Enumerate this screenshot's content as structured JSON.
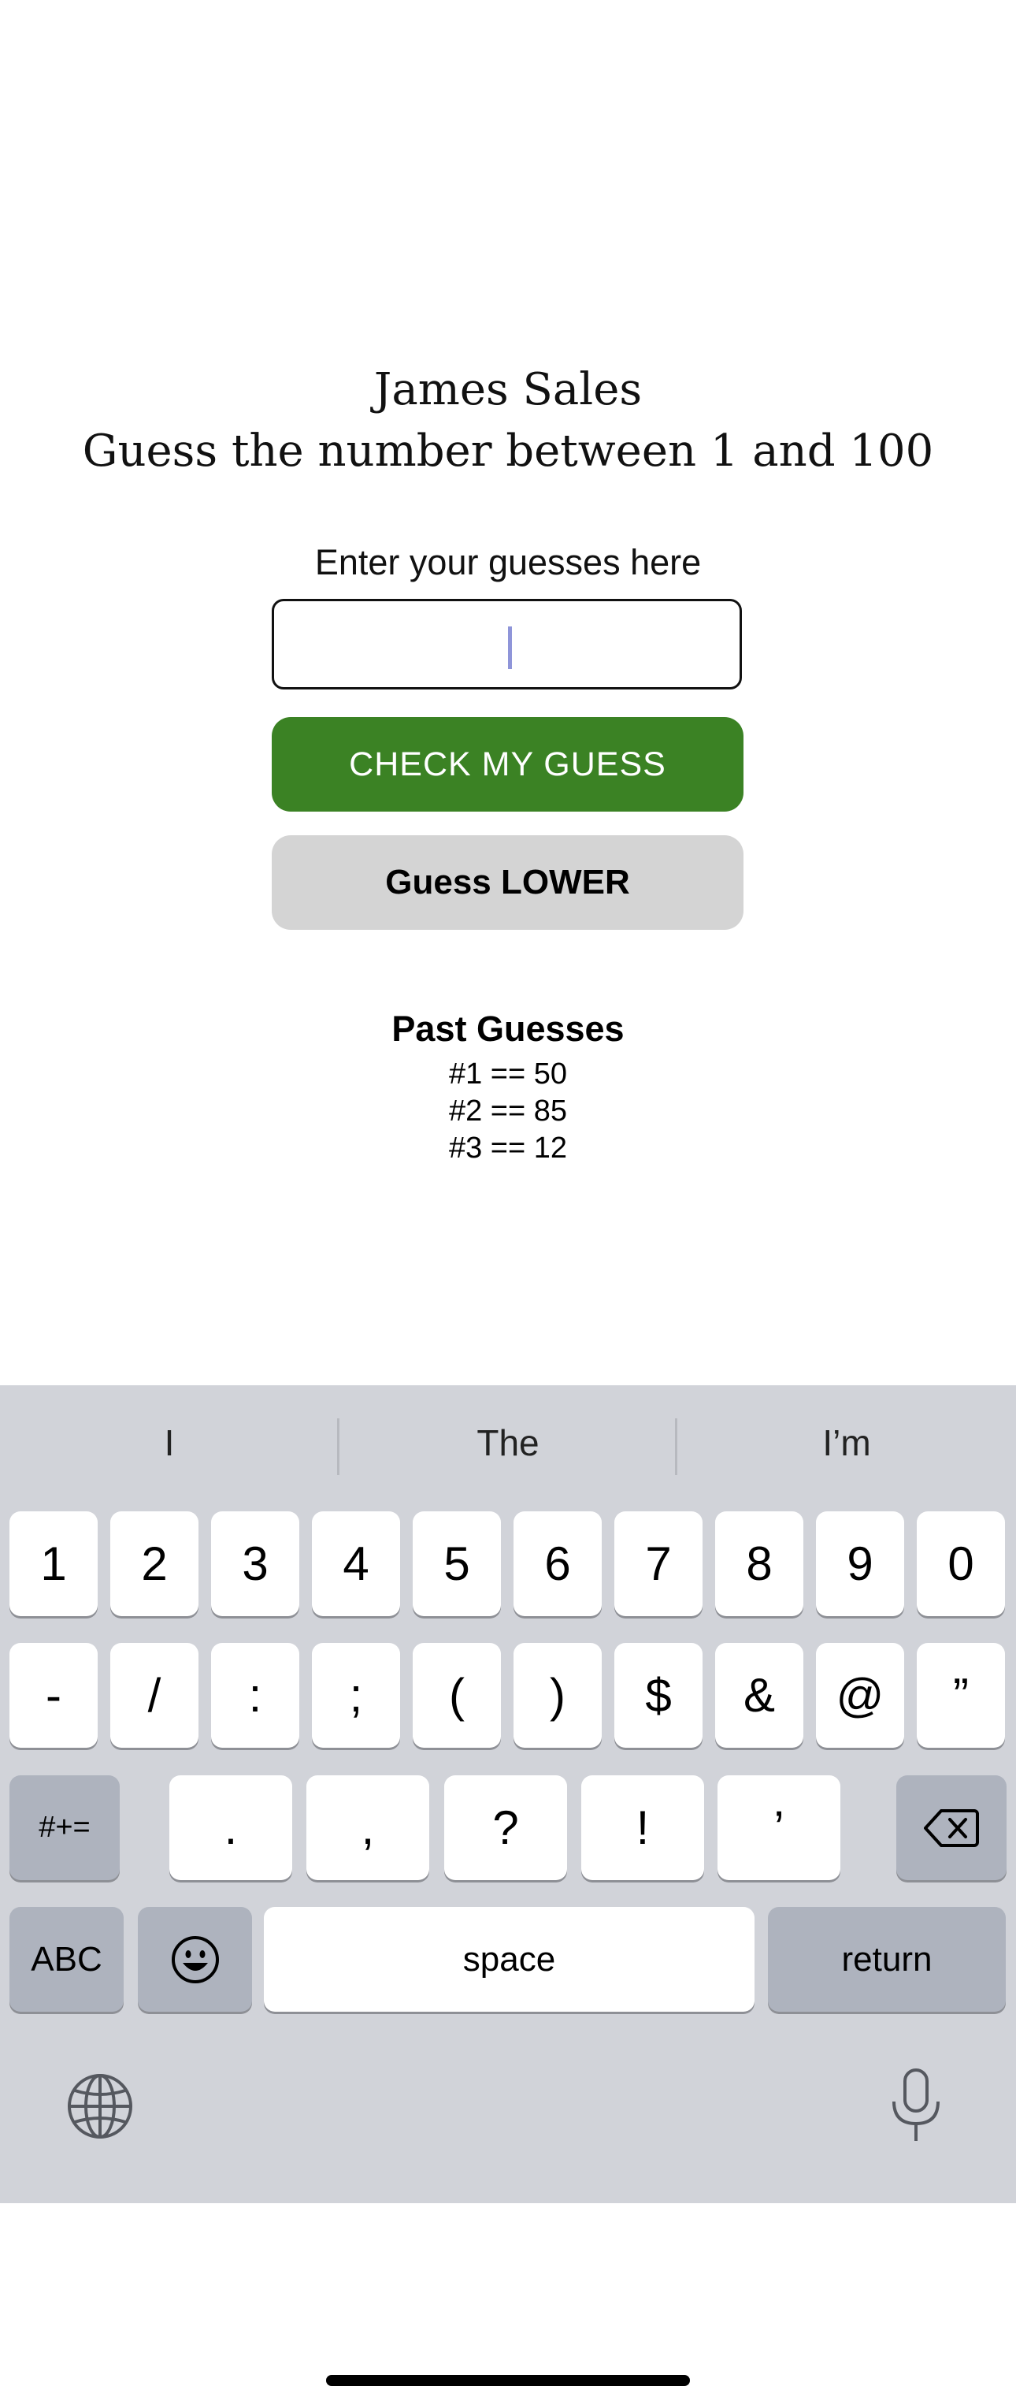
{
  "app": {
    "title_line1": "James Sales",
    "title_line2": "Guess the number between 1 and 100",
    "input_label": "Enter your guesses here",
    "input_value": "",
    "check_button_label": "CHECK MY GUESS",
    "hint_label": "Guess LOWER",
    "past_guesses_title": "Past Guesses",
    "past_guesses": [
      "#1 == 50",
      "#2 == 85",
      "#3 == 12"
    ],
    "colors": {
      "check_button": "#3b8224",
      "hint_button": "#d4d4d4"
    }
  },
  "keyboard": {
    "suggestions": [
      "I",
      "The",
      "I’m"
    ],
    "row1": [
      "1",
      "2",
      "3",
      "4",
      "5",
      "6",
      "7",
      "8",
      "9",
      "0"
    ],
    "row2": [
      "-",
      "/",
      ":",
      ";",
      "(",
      ")",
      "$",
      "&",
      "@",
      "”"
    ],
    "row3_left": "#+=",
    "row3": [
      ".",
      ",",
      "?",
      "!",
      "’"
    ],
    "row3_right_icon": "backspace-icon",
    "row4": {
      "abc": "ABC",
      "emoji_icon": "emoji-icon",
      "space": "space",
      "return": "return"
    },
    "bottom_icons": [
      "globe-icon",
      "microphone-icon"
    ]
  }
}
